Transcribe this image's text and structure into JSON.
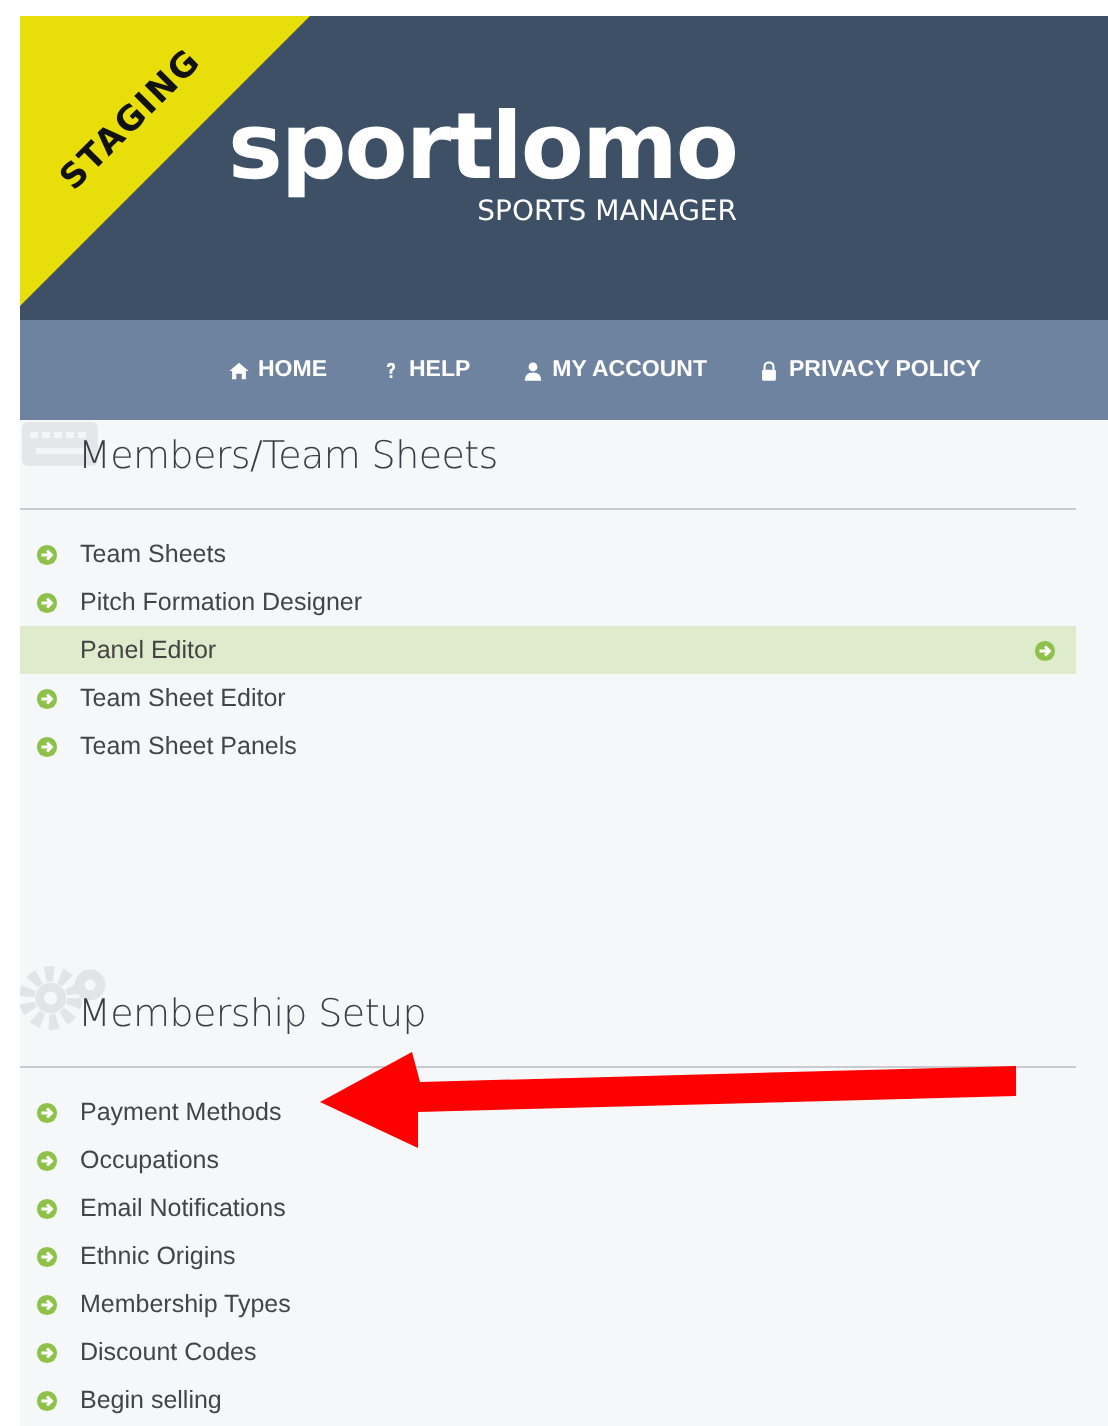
{
  "header": {
    "ribbon": "STAGING",
    "logo": "sportlomo",
    "tagline": "SPORTS MANAGER"
  },
  "nav": [
    {
      "label": "HOME"
    },
    {
      "label": "HELP"
    },
    {
      "label": "MY ACCOUNT"
    },
    {
      "label": "PRIVACY POLICY"
    }
  ],
  "sections": [
    {
      "title": "Members/Team Sheets",
      "items": [
        {
          "label": "Team Sheets",
          "selected": false
        },
        {
          "label": "Pitch Formation Designer",
          "selected": false
        },
        {
          "label": "Panel Editor",
          "selected": true
        },
        {
          "label": "Team Sheet Editor",
          "selected": false
        },
        {
          "label": "Team Sheet Panels",
          "selected": false
        }
      ]
    },
    {
      "title": "Membership Setup",
      "items": [
        {
          "label": "Payment Methods",
          "selected": false
        },
        {
          "label": "Occupations",
          "selected": false
        },
        {
          "label": "Email Notifications",
          "selected": false
        },
        {
          "label": "Ethnic Origins",
          "selected": false
        },
        {
          "label": "Membership Types",
          "selected": false
        },
        {
          "label": "Discount Codes",
          "selected": false
        },
        {
          "label": "Begin selling",
          "selected": false
        }
      ]
    }
  ]
}
